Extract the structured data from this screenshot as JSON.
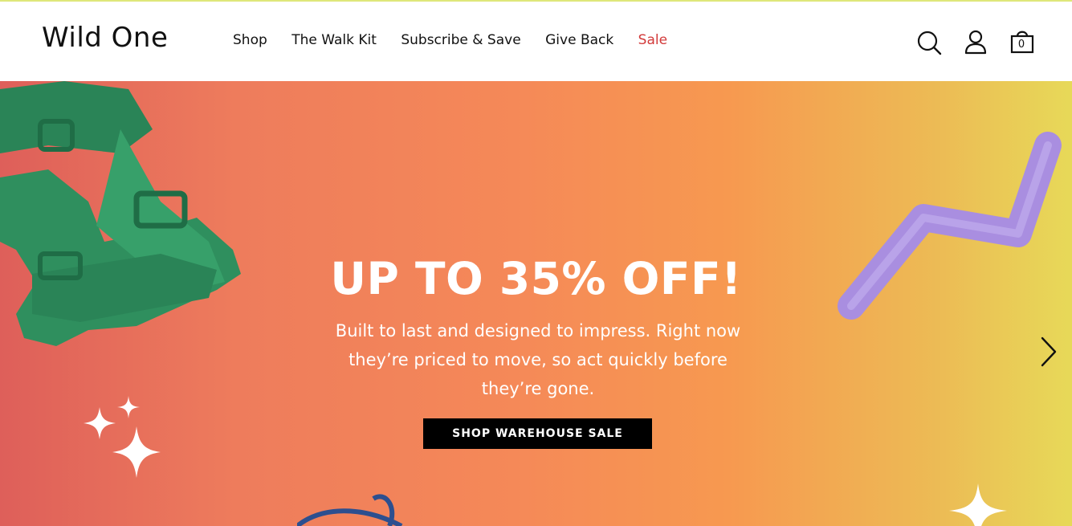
{
  "header": {
    "logo": "Wild One",
    "nav": [
      "Shop",
      "The Walk Kit",
      "Subscribe & Save",
      "Give Back",
      "Sale"
    ],
    "cart_count": "0",
    "icons": [
      "search-icon",
      "account-icon",
      "cart-icon"
    ]
  },
  "hero": {
    "headline": "UP TO 35% OFF!",
    "subtext": "Built to last and designed to impress. Right now they’re priced to move, so act quickly before they’re gone.",
    "cta": "SHOP WAREHOUSE SALE",
    "next_icon": "chevron-right-icon"
  },
  "colors": {
    "accent_line": "#dfe77a",
    "sale": "#d23a3a",
    "harness": "#2f8f5e",
    "toy": "#a98ee0",
    "leash": "#2d4f8f"
  }
}
